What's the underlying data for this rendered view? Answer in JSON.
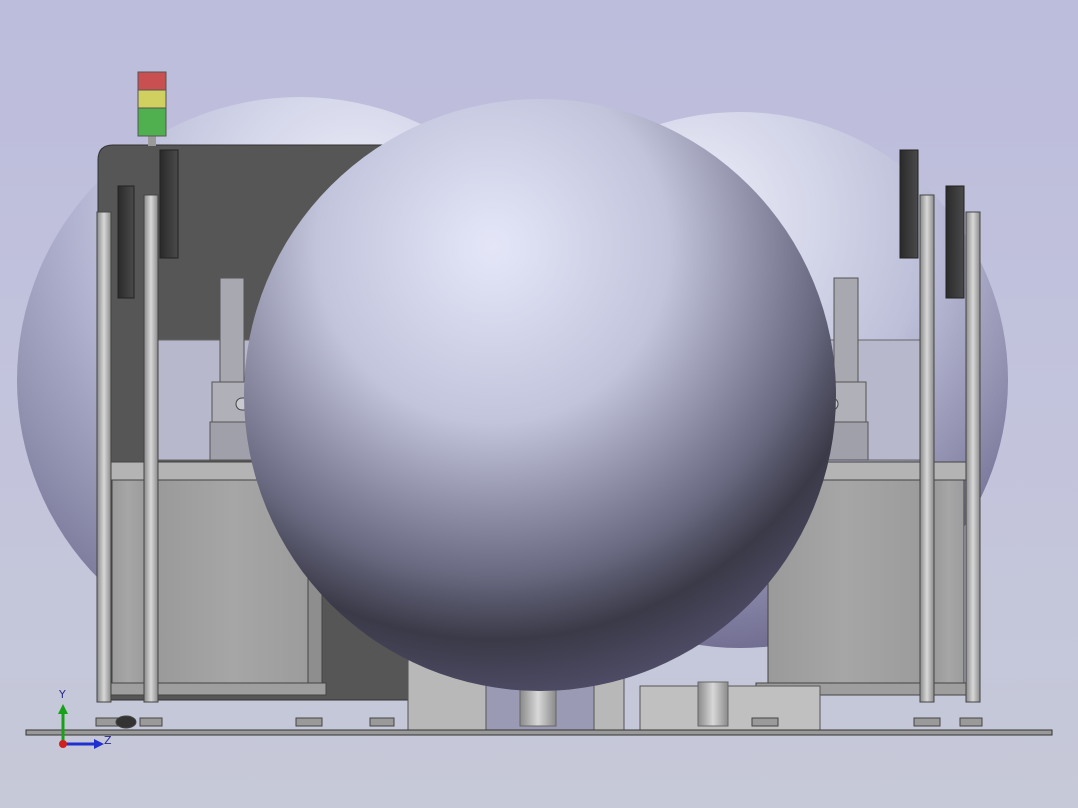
{
  "viewport": {
    "background_top": "#bcbcdc",
    "background_bottom": "#c6c9d8"
  },
  "triad": {
    "y_label": "Y",
    "z_label": "Z",
    "x_color": "#d02020",
    "y_color": "#18a018",
    "z_color": "#2030d0"
  },
  "stack_light": {
    "colors": [
      "#c85050",
      "#d0d060",
      "#50b050"
    ]
  }
}
